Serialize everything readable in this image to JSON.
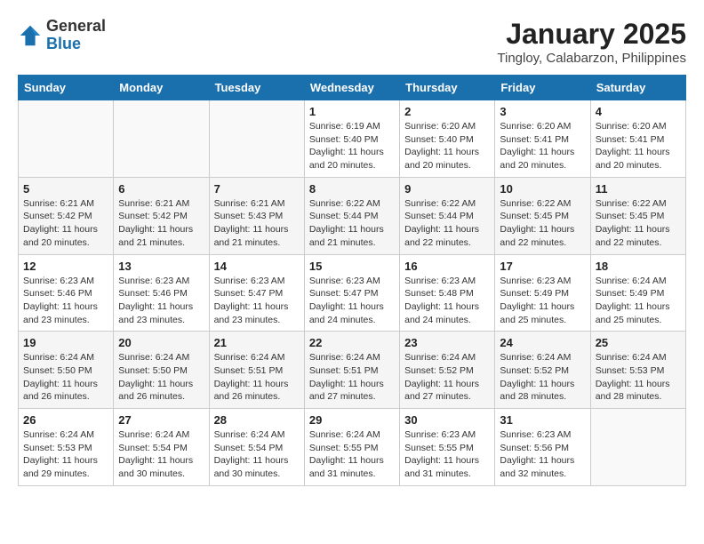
{
  "logo": {
    "general": "General",
    "blue": "Blue"
  },
  "title": "January 2025",
  "subtitle": "Tingloy, Calabarzon, Philippines",
  "weekdays": [
    "Sunday",
    "Monday",
    "Tuesday",
    "Wednesday",
    "Thursday",
    "Friday",
    "Saturday"
  ],
  "weeks": [
    [
      {
        "day": "",
        "info": ""
      },
      {
        "day": "",
        "info": ""
      },
      {
        "day": "",
        "info": ""
      },
      {
        "day": "1",
        "info": "Sunrise: 6:19 AM\nSunset: 5:40 PM\nDaylight: 11 hours and 20 minutes."
      },
      {
        "day": "2",
        "info": "Sunrise: 6:20 AM\nSunset: 5:40 PM\nDaylight: 11 hours and 20 minutes."
      },
      {
        "day": "3",
        "info": "Sunrise: 6:20 AM\nSunset: 5:41 PM\nDaylight: 11 hours and 20 minutes."
      },
      {
        "day": "4",
        "info": "Sunrise: 6:20 AM\nSunset: 5:41 PM\nDaylight: 11 hours and 20 minutes."
      }
    ],
    [
      {
        "day": "5",
        "info": "Sunrise: 6:21 AM\nSunset: 5:42 PM\nDaylight: 11 hours and 20 minutes."
      },
      {
        "day": "6",
        "info": "Sunrise: 6:21 AM\nSunset: 5:42 PM\nDaylight: 11 hours and 21 minutes."
      },
      {
        "day": "7",
        "info": "Sunrise: 6:21 AM\nSunset: 5:43 PM\nDaylight: 11 hours and 21 minutes."
      },
      {
        "day": "8",
        "info": "Sunrise: 6:22 AM\nSunset: 5:44 PM\nDaylight: 11 hours and 21 minutes."
      },
      {
        "day": "9",
        "info": "Sunrise: 6:22 AM\nSunset: 5:44 PM\nDaylight: 11 hours and 22 minutes."
      },
      {
        "day": "10",
        "info": "Sunrise: 6:22 AM\nSunset: 5:45 PM\nDaylight: 11 hours and 22 minutes."
      },
      {
        "day": "11",
        "info": "Sunrise: 6:22 AM\nSunset: 5:45 PM\nDaylight: 11 hours and 22 minutes."
      }
    ],
    [
      {
        "day": "12",
        "info": "Sunrise: 6:23 AM\nSunset: 5:46 PM\nDaylight: 11 hours and 23 minutes."
      },
      {
        "day": "13",
        "info": "Sunrise: 6:23 AM\nSunset: 5:46 PM\nDaylight: 11 hours and 23 minutes."
      },
      {
        "day": "14",
        "info": "Sunrise: 6:23 AM\nSunset: 5:47 PM\nDaylight: 11 hours and 23 minutes."
      },
      {
        "day": "15",
        "info": "Sunrise: 6:23 AM\nSunset: 5:47 PM\nDaylight: 11 hours and 24 minutes."
      },
      {
        "day": "16",
        "info": "Sunrise: 6:23 AM\nSunset: 5:48 PM\nDaylight: 11 hours and 24 minutes."
      },
      {
        "day": "17",
        "info": "Sunrise: 6:23 AM\nSunset: 5:49 PM\nDaylight: 11 hours and 25 minutes."
      },
      {
        "day": "18",
        "info": "Sunrise: 6:24 AM\nSunset: 5:49 PM\nDaylight: 11 hours and 25 minutes."
      }
    ],
    [
      {
        "day": "19",
        "info": "Sunrise: 6:24 AM\nSunset: 5:50 PM\nDaylight: 11 hours and 26 minutes."
      },
      {
        "day": "20",
        "info": "Sunrise: 6:24 AM\nSunset: 5:50 PM\nDaylight: 11 hours and 26 minutes."
      },
      {
        "day": "21",
        "info": "Sunrise: 6:24 AM\nSunset: 5:51 PM\nDaylight: 11 hours and 26 minutes."
      },
      {
        "day": "22",
        "info": "Sunrise: 6:24 AM\nSunset: 5:51 PM\nDaylight: 11 hours and 27 minutes."
      },
      {
        "day": "23",
        "info": "Sunrise: 6:24 AM\nSunset: 5:52 PM\nDaylight: 11 hours and 27 minutes."
      },
      {
        "day": "24",
        "info": "Sunrise: 6:24 AM\nSunset: 5:52 PM\nDaylight: 11 hours and 28 minutes."
      },
      {
        "day": "25",
        "info": "Sunrise: 6:24 AM\nSunset: 5:53 PM\nDaylight: 11 hours and 28 minutes."
      }
    ],
    [
      {
        "day": "26",
        "info": "Sunrise: 6:24 AM\nSunset: 5:53 PM\nDaylight: 11 hours and 29 minutes."
      },
      {
        "day": "27",
        "info": "Sunrise: 6:24 AM\nSunset: 5:54 PM\nDaylight: 11 hours and 30 minutes."
      },
      {
        "day": "28",
        "info": "Sunrise: 6:24 AM\nSunset: 5:54 PM\nDaylight: 11 hours and 30 minutes."
      },
      {
        "day": "29",
        "info": "Sunrise: 6:24 AM\nSunset: 5:55 PM\nDaylight: 11 hours and 31 minutes."
      },
      {
        "day": "30",
        "info": "Sunrise: 6:23 AM\nSunset: 5:55 PM\nDaylight: 11 hours and 31 minutes."
      },
      {
        "day": "31",
        "info": "Sunrise: 6:23 AM\nSunset: 5:56 PM\nDaylight: 11 hours and 32 minutes."
      },
      {
        "day": "",
        "info": ""
      }
    ]
  ]
}
